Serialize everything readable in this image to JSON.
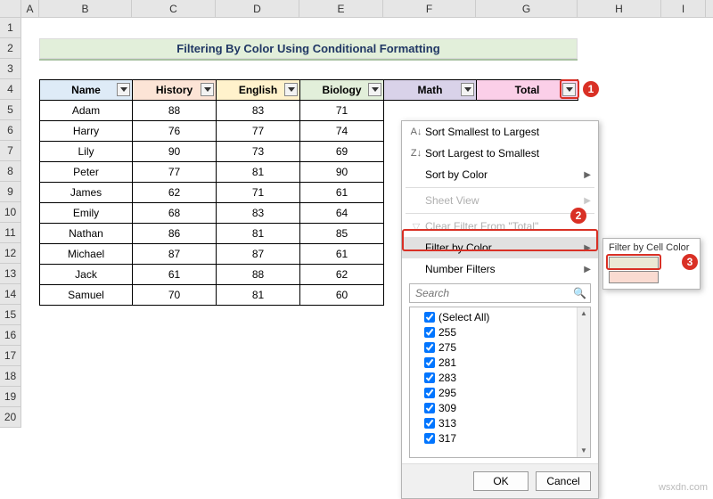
{
  "columns": [
    "A",
    "B",
    "C",
    "D",
    "E",
    "F",
    "G",
    "H",
    "I"
  ],
  "rows": [
    "1",
    "2",
    "3",
    "4",
    "5",
    "6",
    "7",
    "8",
    "9",
    "10",
    "11",
    "12",
    "13",
    "14",
    "15",
    "16",
    "17",
    "18",
    "19",
    "20"
  ],
  "title": "Filtering By Color Using Conditional Formatting",
  "headers": {
    "name": "Name",
    "history": "History",
    "english": "English",
    "biology": "Biology",
    "math": "Math",
    "total": "Total"
  },
  "students": [
    {
      "name": "Adam",
      "history": "88",
      "english": "83",
      "biology": "71"
    },
    {
      "name": "Harry",
      "history": "76",
      "english": "77",
      "biology": "74"
    },
    {
      "name": "Lily",
      "history": "90",
      "english": "73",
      "biology": "69"
    },
    {
      "name": "Peter",
      "history": "77",
      "english": "81",
      "biology": "90"
    },
    {
      "name": "James",
      "history": "62",
      "english": "71",
      "biology": "61"
    },
    {
      "name": "Emily",
      "history": "68",
      "english": "83",
      "biology": "64"
    },
    {
      "name": "Nathan",
      "history": "86",
      "english": "81",
      "biology": "85"
    },
    {
      "name": "Michael",
      "history": "87",
      "english": "87",
      "biology": "61"
    },
    {
      "name": "Jack",
      "history": "61",
      "english": "88",
      "biology": "62"
    },
    {
      "name": "Samuel",
      "history": "70",
      "english": "81",
      "biology": "60"
    }
  ],
  "menu": {
    "sort_asc": "Sort Smallest to Largest",
    "sort_desc": "Sort Largest to Smallest",
    "sort_color": "Sort by Color",
    "sheet_view": "Sheet View",
    "clear": "Clear Filter From \"Total\"",
    "filter_color": "Filter by Color",
    "number_filters": "Number Filters",
    "search_placeholder": "Search",
    "select_all": "(Select All)",
    "values": [
      "255",
      "275",
      "281",
      "283",
      "295",
      "309",
      "313",
      "317"
    ],
    "ok": "OK",
    "cancel": "Cancel"
  },
  "submenu": {
    "title": "Filter by Cell Color"
  },
  "callouts": {
    "c1": "1",
    "c2": "2",
    "c3": "3"
  },
  "watermark": "wsxdn.com"
}
